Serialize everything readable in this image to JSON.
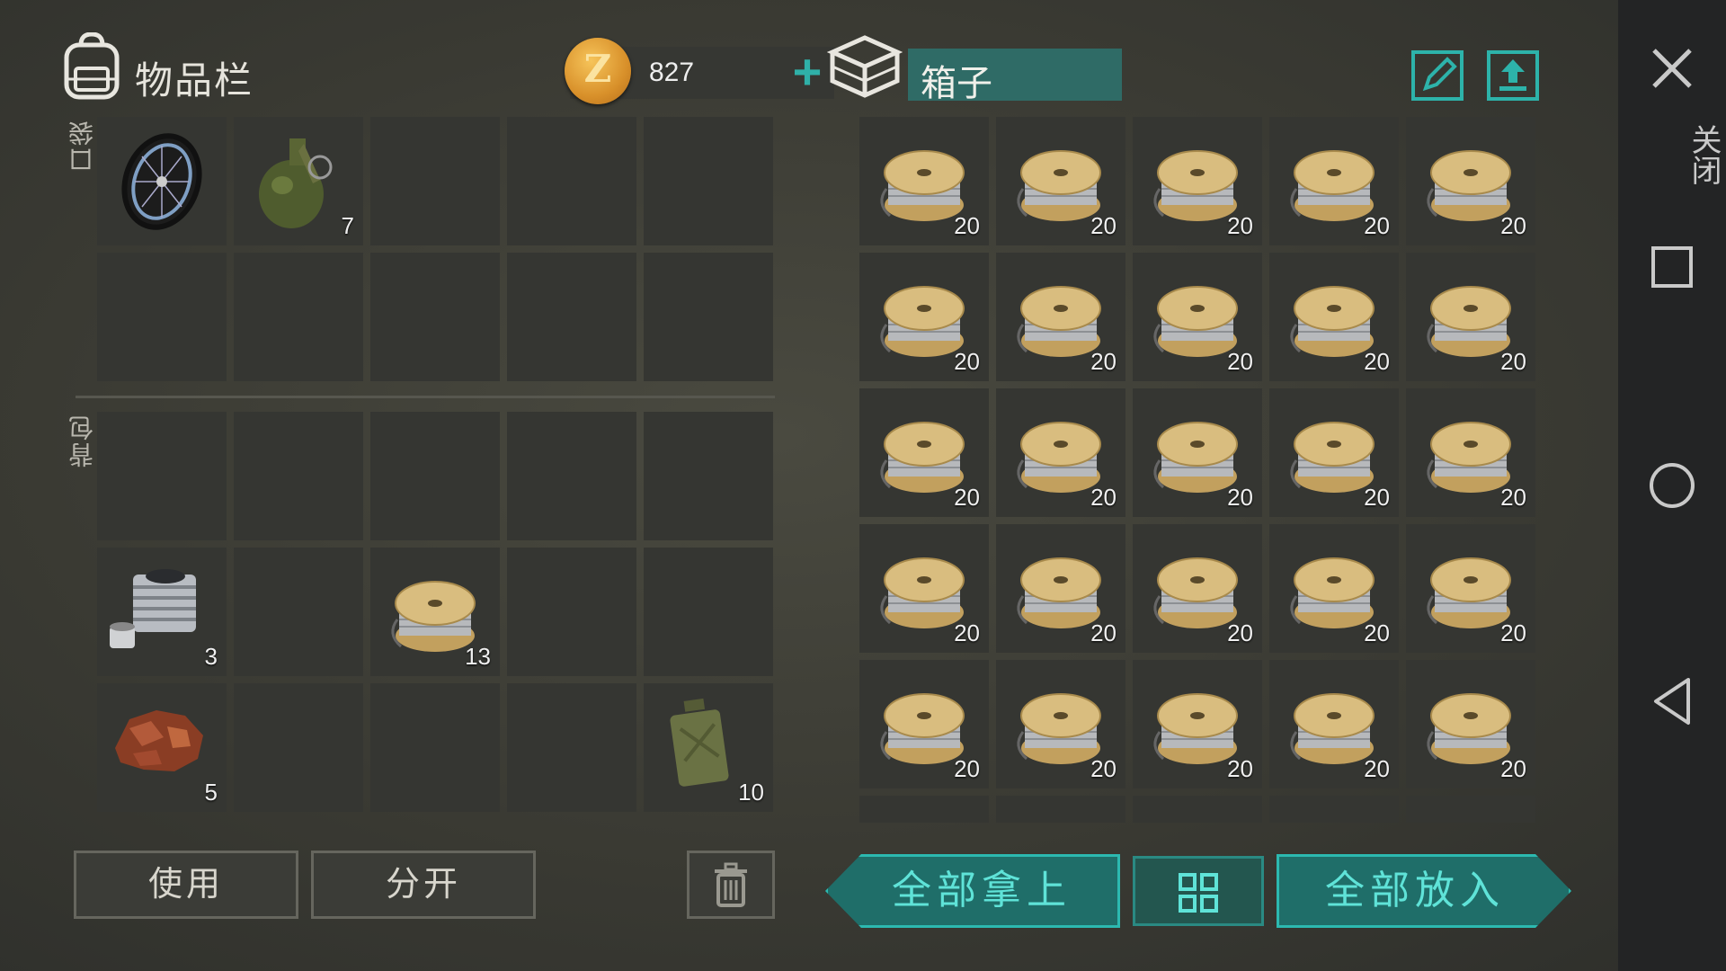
{
  "inventory": {
    "title": "物品栏",
    "coins": "827",
    "coin_symbol": "Z",
    "pocket_label": "口袋",
    "backpack_label": "背包",
    "pocket_slots": [
      {
        "item": "wheel-icon",
        "count": ""
      },
      {
        "item": "grenade-icon",
        "count": "7"
      },
      {
        "item": "",
        "count": ""
      },
      {
        "item": "",
        "count": ""
      },
      {
        "item": "",
        "count": ""
      },
      {
        "item": "",
        "count": ""
      },
      {
        "item": "",
        "count": ""
      },
      {
        "item": "",
        "count": ""
      },
      {
        "item": "",
        "count": ""
      },
      {
        "item": "",
        "count": ""
      }
    ],
    "backpack_slots": [
      {
        "item": "",
        "count": ""
      },
      {
        "item": "",
        "count": ""
      },
      {
        "item": "",
        "count": ""
      },
      {
        "item": "",
        "count": ""
      },
      {
        "item": "",
        "count": ""
      },
      {
        "item": "engine-cylinder-icon",
        "count": "3"
      },
      {
        "item": "",
        "count": ""
      },
      {
        "item": "wire-spool-icon",
        "count": "13"
      },
      {
        "item": "",
        "count": ""
      },
      {
        "item": "",
        "count": ""
      },
      {
        "item": "copper-ore-icon",
        "count": "5"
      },
      {
        "item": "",
        "count": ""
      },
      {
        "item": "",
        "count": ""
      },
      {
        "item": "",
        "count": ""
      },
      {
        "item": "jerrycan-icon",
        "count": "10"
      }
    ],
    "use_label": "使用",
    "split_label": "分开",
    "trash_icon": "trash-icon"
  },
  "box": {
    "title": "箱子",
    "slot_item": "wire-spool-icon",
    "slot_count": "20",
    "filled_slots": 25,
    "take_all_label": "全部拿上",
    "put_all_label": "全部放入",
    "sort_icon": "grid-sort-icon"
  },
  "nav": {
    "close_label": "关闭"
  },
  "colors": {
    "accent_teal": "#2cb9b0",
    "coin_gold": "#d8902a",
    "slot_bg": "#353632"
  }
}
